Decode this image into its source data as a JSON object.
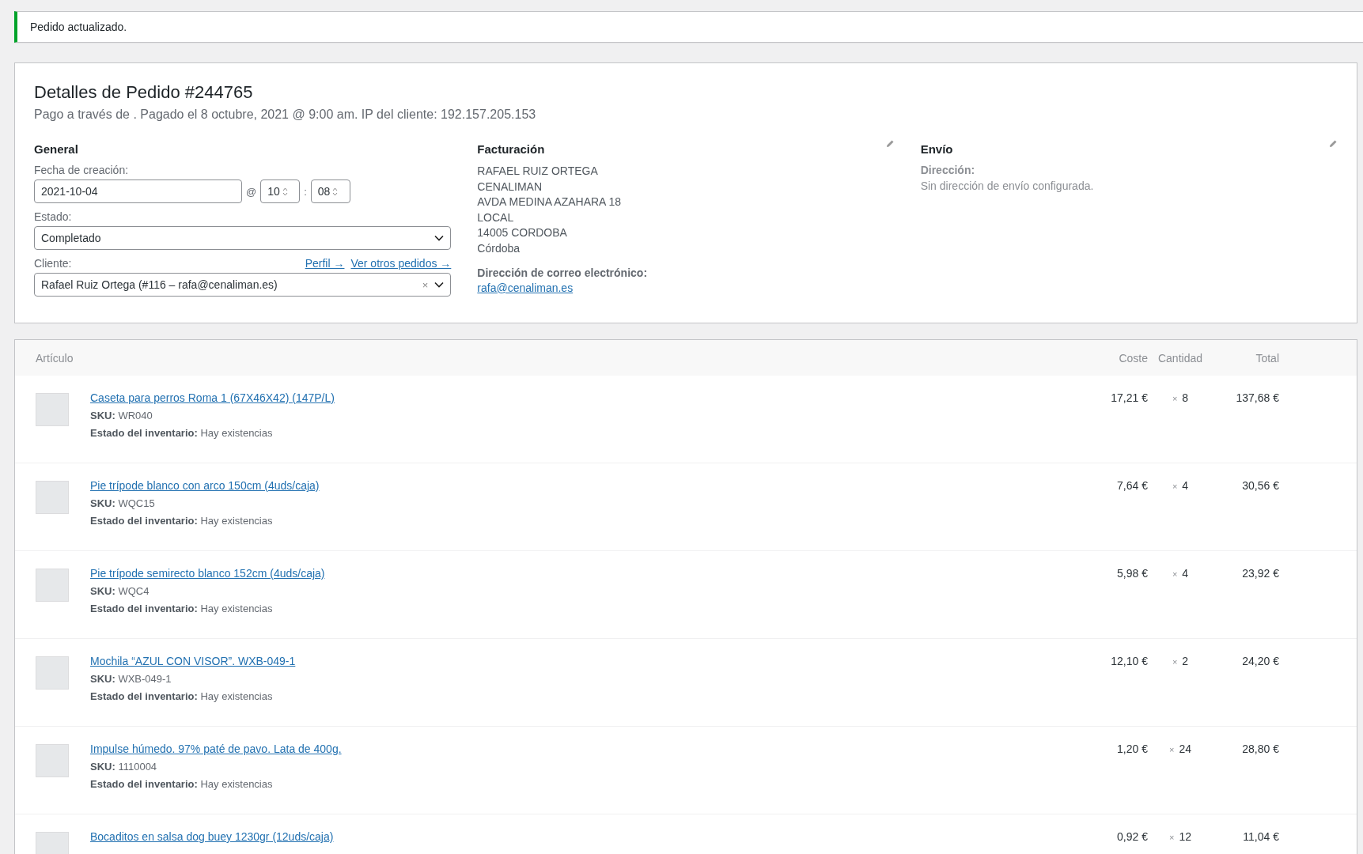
{
  "notice": {
    "text": "Pedido actualizado."
  },
  "order": {
    "title": "Detalles de Pedido #244765",
    "subtitle": "Pago a través de . Pagado el 8 octubre, 2021 @ 9:00 am. IP del cliente: 192.157.205.153",
    "general": {
      "heading": "General",
      "date_label": "Fecha de creación:",
      "date": "2021-10-04",
      "at": "@",
      "hour": "10",
      "colon": ":",
      "minute": "08",
      "status_label": "Estado:",
      "status": "Completado",
      "customer_label": "Cliente:",
      "links": [
        "Perfil →",
        "Ver otros pedidos →"
      ],
      "customer": "Rafael Ruiz Ortega (#116 – rafa@cenaliman.es)",
      "clear": "×"
    },
    "billing": {
      "heading": "Facturación",
      "address": [
        "RAFAEL RUIZ ORTEGA",
        "CENALIMAN",
        "AVDA MEDINA AZAHARA 18",
        "LOCAL",
        "14005 CORDOBA",
        "Córdoba"
      ],
      "email_label": "Dirección de correo electrónico:",
      "email": "rafa@cenaliman.es"
    },
    "shipping": {
      "heading": "Envío",
      "address_label": "Dirección:",
      "address": "Sin dirección de envío configurada."
    }
  },
  "items": {
    "columns": [
      "Artículo",
      "Coste",
      "Cantidad",
      "Total"
    ],
    "rows": [
      {
        "name": "Caseta para perros Roma 1 (67X46X42) (147P/L)",
        "sku_label": "SKU:",
        "sku": "WR040",
        "stock_label": "Estado del inventario:",
        "stock": "Hay existencias",
        "cost": "17,21 €",
        "times": "×",
        "quantity": "8",
        "total": "137,68 €"
      },
      {
        "name": "Pie trípode blanco con arco 150cm (4uds/caja)",
        "sku_label": "SKU:",
        "sku": "WQC15",
        "stock_label": "Estado del inventario:",
        "stock": "Hay existencias",
        "cost": "7,64 €",
        "times": "×",
        "quantity": "4",
        "total": "30,56 €"
      },
      {
        "name": "Pie trípode semirecto blanco 152cm (4uds/caja)",
        "sku_label": "SKU:",
        "sku": "WQC4",
        "stock_label": "Estado del inventario:",
        "stock": "Hay existencias",
        "cost": "5,98 €",
        "times": "×",
        "quantity": "4",
        "total": "23,92 €"
      },
      {
        "name": "Mochila “AZUL CON VISOR”. WXB-049-1",
        "sku_label": "SKU:",
        "sku": "WXB-049-1",
        "stock_label": "Estado del inventario:",
        "stock": "Hay existencias",
        "cost": "12,10 €",
        "times": "×",
        "quantity": "2",
        "total": "24,20 €"
      },
      {
        "name": "Impulse húmedo. 97% paté de pavo. Lata de 400g.",
        "sku_label": "SKU:",
        "sku": "1110004",
        "stock_label": "Estado del inventario:",
        "stock": "Hay existencias",
        "cost": "1,20 €",
        "times": "×",
        "quantity": "24",
        "total": "28,80 €"
      },
      {
        "name": "Bocaditos en salsa dog buey 1230gr (12uds/caja)",
        "cost": "0,92 €",
        "times": "×",
        "quantity": "12",
        "total": "11,04 €"
      }
    ]
  }
}
